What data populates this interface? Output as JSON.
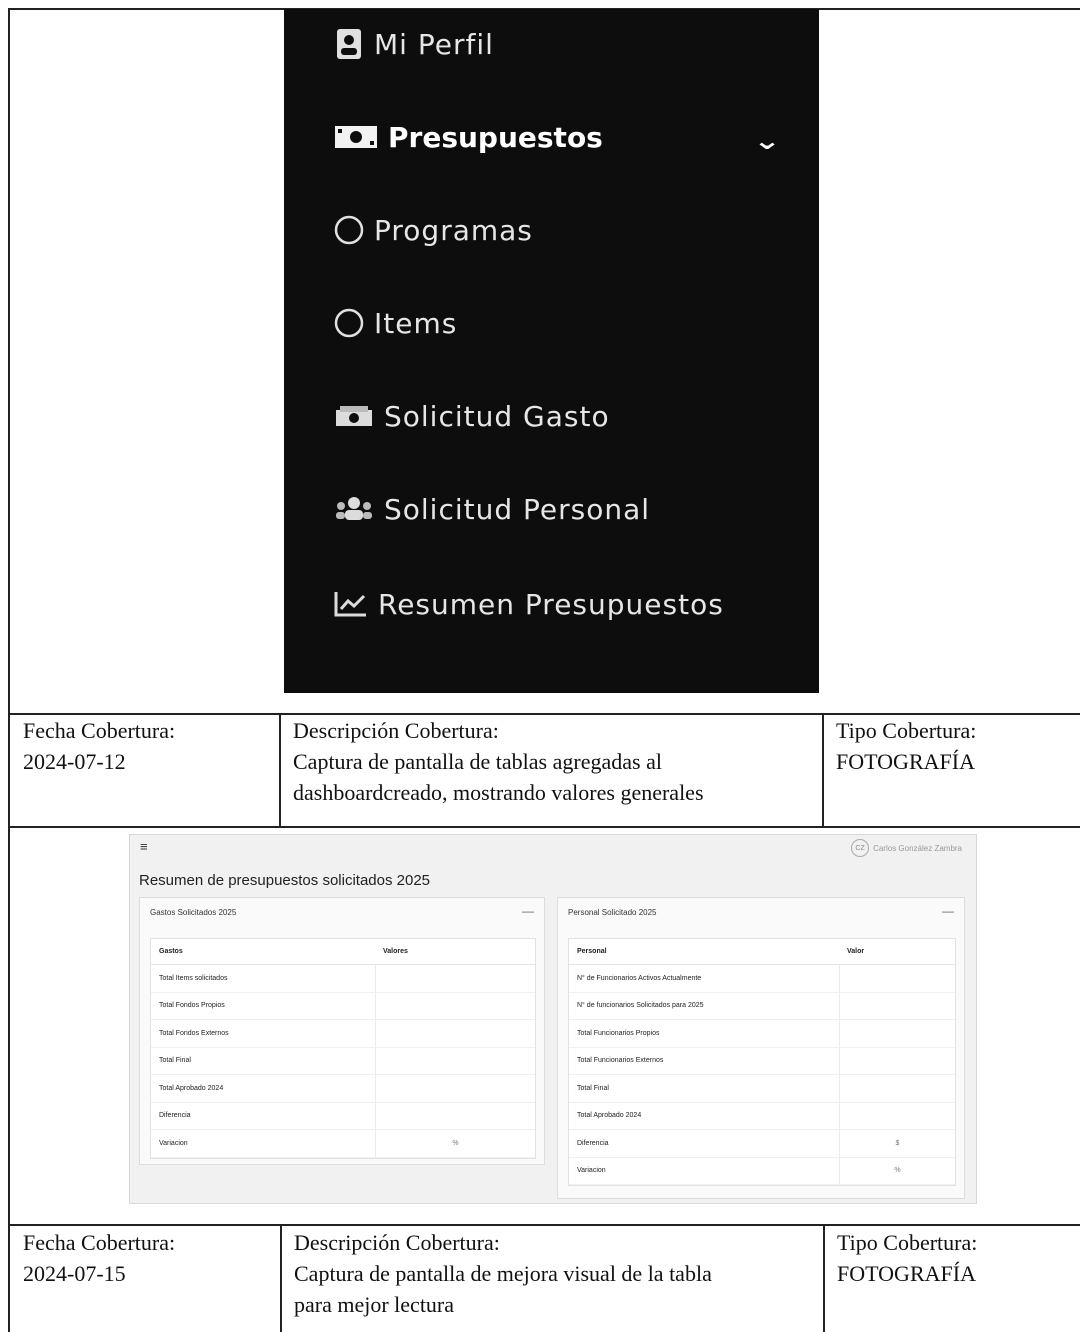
{
  "sidebar": {
    "items": [
      {
        "label": "Mi Perfil",
        "icon": "user-badge-icon"
      },
      {
        "label": "Presupuestos",
        "icon": "money-bill-icon",
        "active": true
      },
      {
        "label": "Programas",
        "icon": "circle-outline-icon"
      },
      {
        "label": "Items",
        "icon": "circle-outline-icon"
      },
      {
        "label": "Solicitud Gasto",
        "icon": "money-stack-icon"
      },
      {
        "label": "Solicitud Personal",
        "icon": "users-icon"
      },
      {
        "label": "Resumen Presupuestos",
        "icon": "line-chart-icon"
      }
    ]
  },
  "entries": [
    {
      "fecha_label": "Fecha Cobertura:",
      "fecha": "2024-07-12",
      "descripcion_label": "Descripción Cobertura:",
      "descripcion_lines": [
        "Captura de pantalla de tablas agregadas al",
        "dashboardcreado, mostrando valores generales"
      ],
      "tipo_label": "Tipo Cobertura:",
      "tipo": "FOTOGRAFÍA"
    },
    {
      "fecha_label": "Fecha Cobertura:",
      "fecha": "2024-07-15",
      "descripcion_label": "Descripción Cobertura:",
      "descripcion_lines": [
        "Captura de pantalla de mejora visual de la tabla",
        "para mejor lectura"
      ],
      "tipo_label": "Tipo Cobertura:",
      "tipo": "FOTOGRAFÍA"
    }
  ],
  "dashboard": {
    "menu_icon": "≡",
    "user_initials": "CZ",
    "user_name": "Carlos González Zambra",
    "title": "Resumen de presupuestos solicitados 2025",
    "gastos_card": {
      "heading": "Gastos Solicitados 2025",
      "collapse": "—",
      "col1": "Gastos",
      "col2": "Valores",
      "rows": [
        {
          "label": "Total Items solicitados",
          "value": ""
        },
        {
          "label": "Total Fondos Propios",
          "value": ""
        },
        {
          "label": "Total Fondos Externos",
          "value": ""
        },
        {
          "label": "Total Final",
          "value": ""
        },
        {
          "label": "Total Aprobado 2024",
          "value": ""
        },
        {
          "label": "Diferencia",
          "value": ""
        },
        {
          "label": "Variacion",
          "value": "%"
        }
      ]
    },
    "personal_card": {
      "heading": "Personal Solicitado 2025",
      "collapse": "—",
      "col1": "Personal",
      "col2": "Valor",
      "rows": [
        {
          "label": "N° de Funcionarios Activos Actualmente",
          "value": ""
        },
        {
          "label": "N° de funcionarios Solicitados para 2025",
          "value": ""
        },
        {
          "label": "Total Funcionarios Propios",
          "value": ""
        },
        {
          "label": "Total Funcionarios Externos",
          "value": ""
        },
        {
          "label": "Total Final",
          "value": ""
        },
        {
          "label": "Total Aprobado 2024",
          "value": ""
        },
        {
          "label": "Diferencia",
          "value": "$"
        },
        {
          "label": "Variacion",
          "value": "%"
        }
      ]
    }
  }
}
